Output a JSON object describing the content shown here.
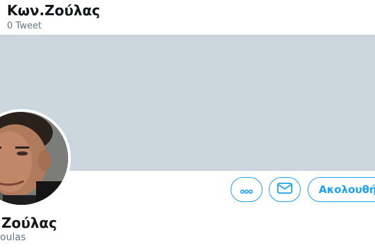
{
  "header": {
    "title": "Κων.Ζούλας",
    "tweet_count": "0 Tweet"
  },
  "profile": {
    "name_visible": "Ζούλας",
    "handle_visible": "oulas"
  },
  "actions": {
    "more_icon": "more-dots-icon",
    "message_icon": "envelope-icon",
    "follow_label": "Ακολουθή"
  },
  "colors": {
    "accent": "#1da1f2",
    "banner": "#ccd6dd",
    "text_primary": "#14171a",
    "text_secondary": "#657786"
  }
}
